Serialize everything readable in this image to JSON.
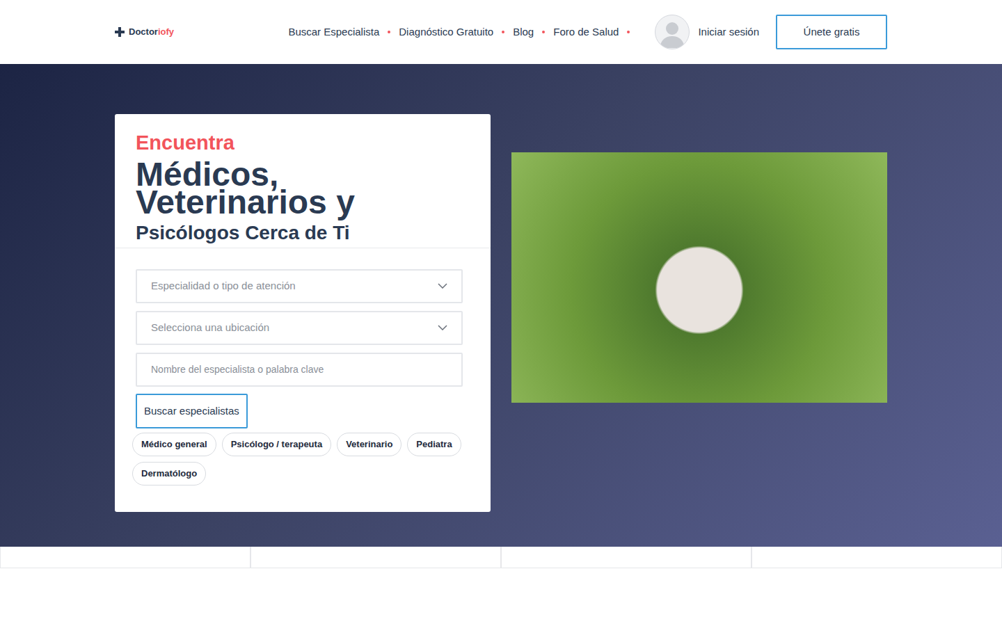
{
  "logo": {
    "first": "Doctor",
    "second": "iofy"
  },
  "nav": {
    "items": [
      {
        "label": "Buscar Especialista"
      },
      {
        "label": "Diagnóstico Gratuito"
      },
      {
        "label": "Blog"
      },
      {
        "label": "Foro de Salud"
      }
    ],
    "login": "Iniciar sesión",
    "signup": "Únete gratis"
  },
  "hero": {
    "kicker": "Encuentra",
    "title": "Médicos, Veterinarios y",
    "subtitle": "Psicólogos Cerca de Ti"
  },
  "form": {
    "specialty": {
      "placeholder": "Especialidad o tipo de atención"
    },
    "location": {
      "placeholder": "Selecciona una ubicación"
    },
    "keyword": {
      "placeholder": "Nombre del especialista o palabra clave"
    },
    "button": "Buscar especialistas"
  },
  "tags": [
    "Médico general",
    "Psicólogo / terapeuta",
    "Veterinario",
    "Pediatra",
    "Dermatólogo"
  ]
}
